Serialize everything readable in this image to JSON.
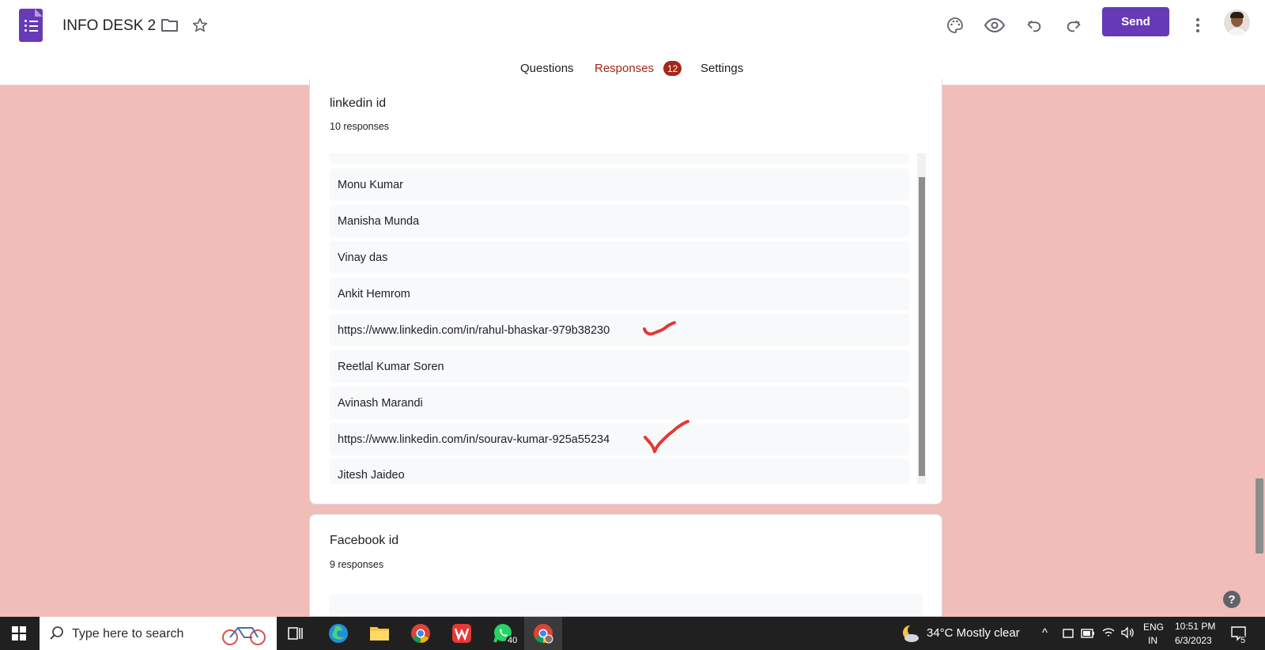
{
  "app": {
    "doc_title": "INFO DESK 2",
    "send_label": "Send"
  },
  "tabs": [
    {
      "label": "Questions",
      "active": false
    },
    {
      "label": "Responses",
      "active": true,
      "badge": "12"
    },
    {
      "label": "Settings",
      "active": false
    }
  ],
  "questions": [
    {
      "title": "linkedin id",
      "count": "10 responses",
      "responses": [
        "Monu Kumar",
        "Manisha Munda",
        "Vinay das",
        "Ankit Hemrom",
        "https://www.linkedin.com/in/rahul-bhaskar-979b38230",
        "Reetlal Kumar Soren",
        "Avinash Marandi",
        "https://www.linkedin.com/in/sourav-kumar-925a55234",
        "Jitesh Jaideo"
      ]
    },
    {
      "title": "Facebook id",
      "count": "9 responses"
    }
  ],
  "taskbar": {
    "search_placeholder": "Type here to search",
    "whatsapp_badge": "40",
    "weather": "34°C  Mostly clear",
    "lang_line1": "ENG",
    "lang_line2": "IN",
    "time": "10:51 PM",
    "date": "6/3/2023",
    "notification_count": "5"
  },
  "colors": {
    "accent": "#673ab7",
    "responses_tab": "#a52714",
    "page_background": "#f0bdb9",
    "annotation_tick": "#e53935"
  }
}
